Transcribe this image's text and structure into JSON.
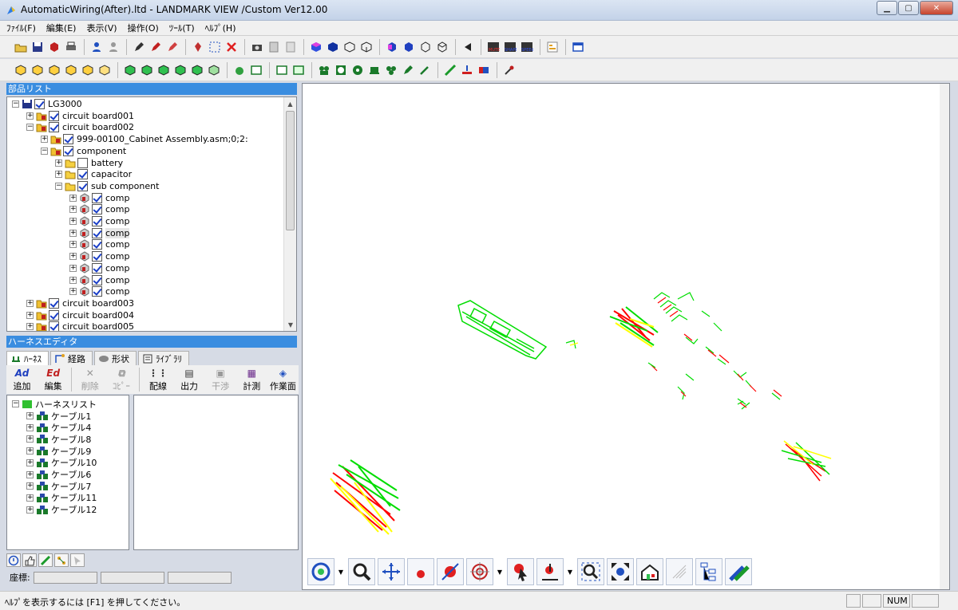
{
  "window": {
    "title": "AutomaticWiring(After).ltd - LANDMARK VIEW /Custom Ver12.00",
    "buttons": [
      "minimize",
      "maximize",
      "close"
    ]
  },
  "menu": [
    "ﾌｧｲﾙ(F)",
    "編集(E)",
    "表示(V)",
    "操作(O)",
    "ﾂｰﾙ(T)",
    "ﾍﾙﾌﾟ(H)"
  ],
  "parts_list": {
    "header": "部品リスト",
    "items": [
      {
        "label": "LG3000",
        "level": 0,
        "expander": "−",
        "checked": true,
        "icon": "assembly-icon"
      },
      {
        "label": "circuit board001",
        "level": 1,
        "expander": "+",
        "checked": true,
        "icon": "folder-part-icon"
      },
      {
        "label": "circuit board002",
        "level": 1,
        "expander": "−",
        "checked": true,
        "icon": "folder-part-icon"
      },
      {
        "label": "999-00100_Cabinet Assembly.asm;0;2:",
        "level": 2,
        "expander": "+",
        "checked": true,
        "icon": "folder-part-icon"
      },
      {
        "label": "component",
        "level": 2,
        "expander": "−",
        "checked": true,
        "icon": "folder-part-icon"
      },
      {
        "label": "battery",
        "level": 3,
        "expander": "+",
        "checked": false,
        "icon": "folder-icon"
      },
      {
        "label": "capacitor",
        "level": 3,
        "expander": "+",
        "checked": true,
        "icon": "folder-icon"
      },
      {
        "label": "sub component",
        "level": 3,
        "expander": "−",
        "checked": true,
        "icon": "folder-icon"
      },
      {
        "label": "comp",
        "level": 4,
        "expander": "+",
        "checked": true,
        "icon": "part-icon"
      },
      {
        "label": "comp",
        "level": 4,
        "expander": "+",
        "checked": true,
        "icon": "part-icon"
      },
      {
        "label": "comp",
        "level": 4,
        "expander": "+",
        "checked": true,
        "icon": "part-icon"
      },
      {
        "label": "comp",
        "level": 4,
        "expander": "+",
        "checked": true,
        "icon": "part-icon",
        "highlight": true
      },
      {
        "label": "comp",
        "level": 4,
        "expander": "+",
        "checked": true,
        "icon": "part-icon"
      },
      {
        "label": "comp",
        "level": 4,
        "expander": "+",
        "checked": true,
        "icon": "part-icon"
      },
      {
        "label": "comp",
        "level": 4,
        "expander": "+",
        "checked": true,
        "icon": "part-icon"
      },
      {
        "label": "comp",
        "level": 4,
        "expander": "+",
        "checked": true,
        "icon": "part-icon"
      },
      {
        "label": "comp",
        "level": 4,
        "expander": "+",
        "checked": true,
        "icon": "part-icon"
      },
      {
        "label": "circuit board003",
        "level": 1,
        "expander": "+",
        "checked": true,
        "icon": "folder-part-icon"
      },
      {
        "label": "circuit board004",
        "level": 1,
        "expander": "+",
        "checked": true,
        "icon": "folder-part-icon"
      },
      {
        "label": "circuit board005",
        "level": 1,
        "expander": "+",
        "checked": true,
        "icon": "folder-part-icon"
      }
    ]
  },
  "harness_editor": {
    "header": "ハーネスエディタ",
    "tabs": [
      {
        "label": "ﾊｰﾈｽ",
        "icon": "harness-icon",
        "active": true
      },
      {
        "label": "経路",
        "icon": "route-icon",
        "active": false
      },
      {
        "label": "形状",
        "icon": "shape-icon",
        "active": false
      },
      {
        "label": "ﾗｲﾌﾞﾗﾘ",
        "icon": "library-icon",
        "active": false
      }
    ],
    "tools": [
      {
        "label": "追加",
        "icon": "Ad",
        "enabled": true
      },
      {
        "label": "編集",
        "icon": "Ed",
        "enabled": true
      },
      {
        "label": "削除",
        "icon": "✕",
        "enabled": false
      },
      {
        "label": "ｺﾋﾟｰ",
        "icon": "⧉",
        "enabled": false
      },
      {
        "label": "配線",
        "icon": "⋮⋮",
        "enabled": true
      },
      {
        "label": "出力",
        "icon": "▤",
        "enabled": true
      },
      {
        "label": "干渉",
        "icon": "▣",
        "enabled": false
      },
      {
        "label": "計測",
        "icon": "▦",
        "enabled": true
      },
      {
        "label": "作業面",
        "icon": "◈",
        "enabled": true
      }
    ],
    "list_root": "ハーネスリスト",
    "cables": [
      "ケーブル1",
      "ケーブル4",
      "ケーブル8",
      "ケーブル9",
      "ケーブル10",
      "ケーブル6",
      "ケーブル7",
      "ケーブル11",
      "ケーブル12"
    ],
    "coord_label": "座標:"
  },
  "status": {
    "help_text": "ﾍﾙﾌﾟを表示するには [F1] を押してください。",
    "num": "NUM"
  },
  "colors": {
    "accent": "#3a8de0",
    "wire_red": "#ff0000",
    "wire_green": "#00dd00",
    "wire_yellow": "#ffff00"
  }
}
